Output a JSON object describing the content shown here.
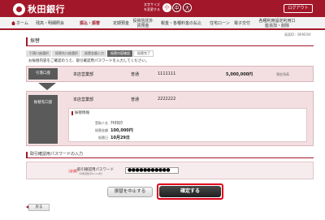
{
  "header": {
    "bank_name": "秋田銀行",
    "font_size_label": "文字サイズを変更する",
    "font_sizes": [
      "小",
      "中",
      "大"
    ],
    "logout": "ログアウト"
  },
  "nav": {
    "home": "ホーム",
    "items": [
      "残高・明細照会",
      "振込・振替",
      "定期預金",
      "投資信託外貨預金",
      "税金・各種料金の払込",
      "住宅ローン",
      "電子交付",
      "各種利用設定利用口座追加・削除"
    ]
  },
  "screen_id": "画面ID：BKM204",
  "page_title": "振替",
  "steps": [
    "引落口座選択",
    "振替先口座選択",
    "振替金額入力",
    "振替内容確認",
    "振替完了"
  ],
  "instruction": "お振替内容をご確認のうえ、取引確認用パスワードを入力してください。",
  "withdraw": {
    "label": "引落口座",
    "branch": "本店営業部",
    "type": "普通",
    "number": "1111111",
    "balance": "5,000,000円",
    "balance_note": "預金残高"
  },
  "transfer_to": {
    "label": "振替先口座",
    "branch": "本店営業部",
    "type": "普通",
    "number": "2222222"
  },
  "transfer_info": {
    "title": "振替情報",
    "rows": [
      {
        "key": "受取人名",
        "value": "ｱｷﾀﾀﾛｳ"
      },
      {
        "key": "振替金額",
        "value": "100,000円"
      },
      {
        "key": "振替日",
        "value": "10月29日"
      }
    ]
  },
  "password": {
    "section_title": "取引確認用パスワードの入力",
    "required": "［必須］",
    "label": "取引確認用パスワード",
    "note": "（半角英数字8～12桁）",
    "value": "●●●●●●●●●●●"
  },
  "buttons": {
    "cancel": "振替を中止する",
    "confirm": "確定する",
    "back": "戻る"
  },
  "colors": {
    "brand": "#a3172a",
    "highlight": "#e0001a"
  }
}
